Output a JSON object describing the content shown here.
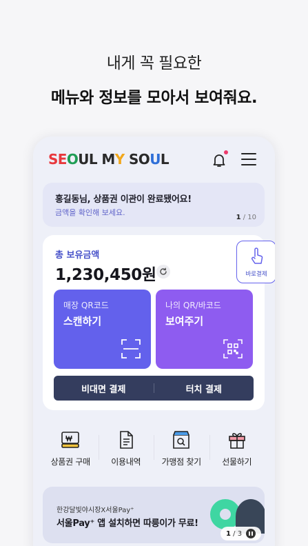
{
  "hero": {
    "line1": "내게 꼭 필요한",
    "line2": "메뉴와 정보를 모아서 보여줘요."
  },
  "app": {
    "logo_parts": [
      "SE",
      "O",
      "UL M",
      "Y",
      " SO",
      "U",
      "L"
    ]
  },
  "notice": {
    "title": "홍길동님, 상품권 이관이 완료됐어요!",
    "subtitle": "금액을 확인해 보세요.",
    "page_current": "1",
    "page_total": " / 10"
  },
  "balance": {
    "label": "총 보유금액",
    "amount": "1,230,450원"
  },
  "quick_pay": {
    "label": "바로결제"
  },
  "tiles": {
    "qr_scan": {
      "small": "매장 QR코드",
      "big": "스캔하기"
    },
    "show_code": {
      "small": "나의 QR/바코드",
      "big": "보여주기"
    }
  },
  "paybar": {
    "contactless": "비대면 결제",
    "touch": "터치 결제"
  },
  "shortcuts": [
    {
      "label": "상품권 구매",
      "icon": "voucher-won-icon"
    },
    {
      "label": "이용내역",
      "icon": "document-icon"
    },
    {
      "label": "가맹점 찾기",
      "icon": "store-search-icon"
    },
    {
      "label": "선물하기",
      "icon": "gift-icon"
    }
  ],
  "banner": {
    "subtitle": "한강달빛야시장X서울Pay⁺",
    "title": "서울Pay⁺ 앱 설치하면 따릉이가 무료!",
    "page_current": "1",
    "page_total": " / 3"
  },
  "colors": {
    "accent": "#6361ec",
    "tile_purple": "#8e5cf0",
    "paybar": "#343d5e",
    "notice_bg": "#e4e6f6",
    "badge": "#ec3b6c"
  }
}
